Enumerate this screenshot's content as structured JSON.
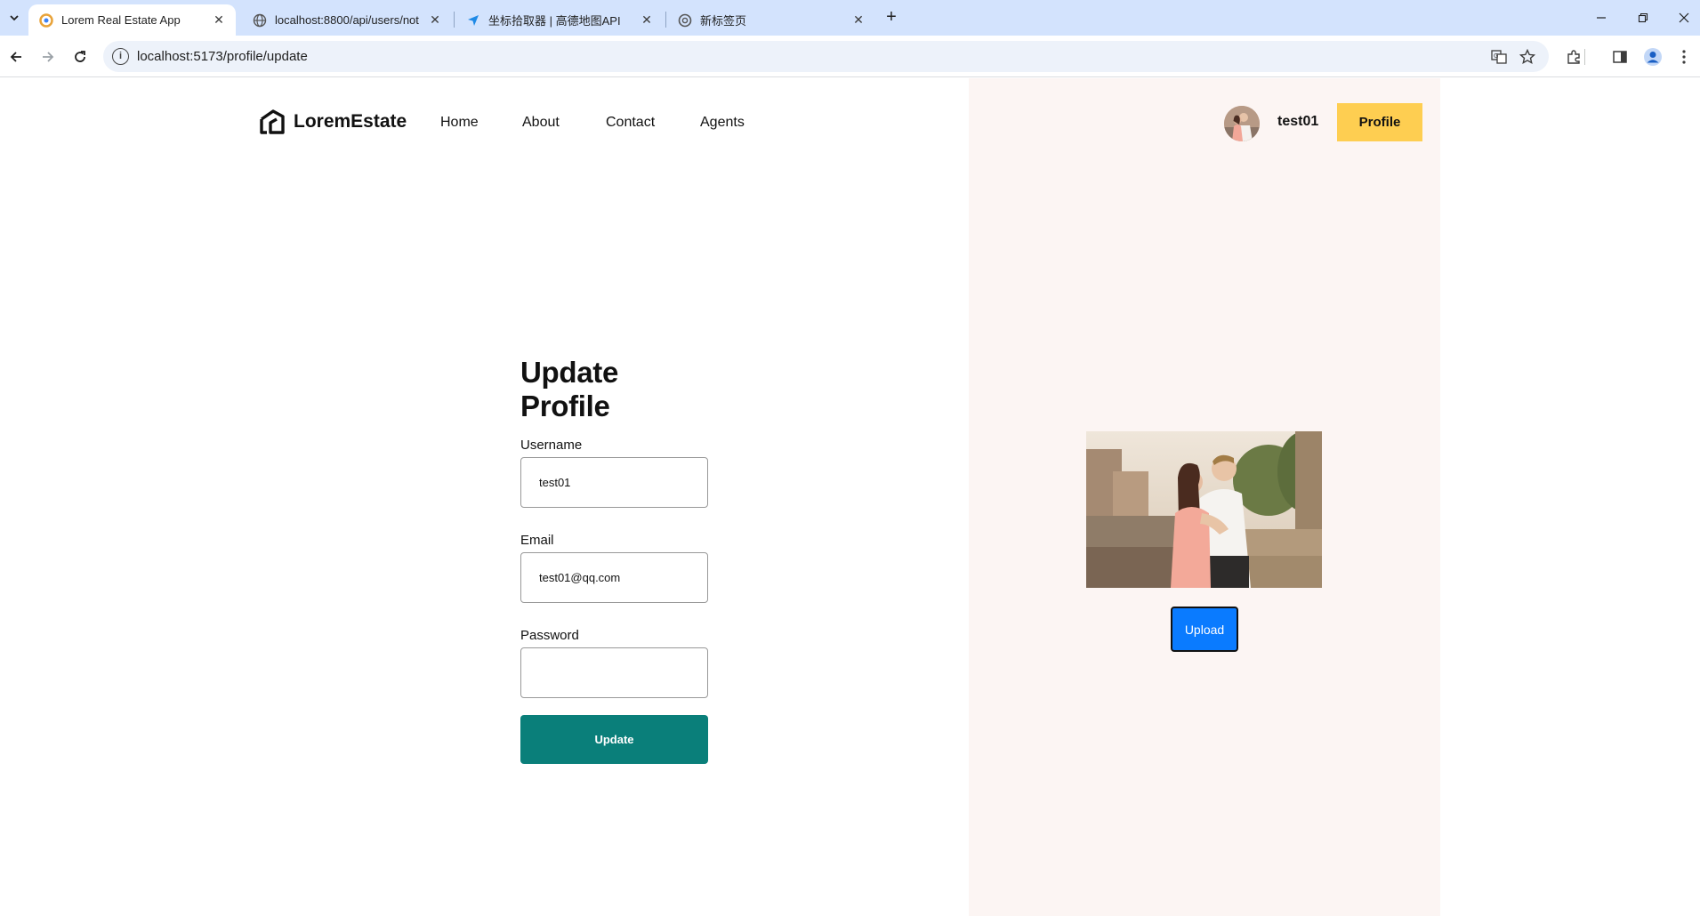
{
  "browser": {
    "tabs": [
      {
        "title": "Lorem Real Estate App",
        "active": true
      },
      {
        "title": "localhost:8800/api/users/not",
        "active": false
      },
      {
        "title": "坐标拾取器 | 高德地图API",
        "active": false
      },
      {
        "title": "新标签页",
        "active": false
      }
    ],
    "url": "localhost:5173/profile/update"
  },
  "navbar": {
    "brand": "LoremEstate",
    "links": [
      "Home",
      "About",
      "Contact",
      "Agents"
    ],
    "username": "test01",
    "profile_button": "Profile",
    "accent_color": "#fece51"
  },
  "form": {
    "title": "Update Profile",
    "fields": [
      {
        "label": "Username",
        "value": "test01"
      },
      {
        "label": "Email",
        "value": "test01@qq.com"
      },
      {
        "label": "Password",
        "value": ""
      }
    ],
    "submit_label": "Update",
    "submit_color": "#0a7f7a"
  },
  "side": {
    "upload_label": "Upload",
    "upload_color": "#0a7bff",
    "panel_color": "#fcf5f3"
  }
}
